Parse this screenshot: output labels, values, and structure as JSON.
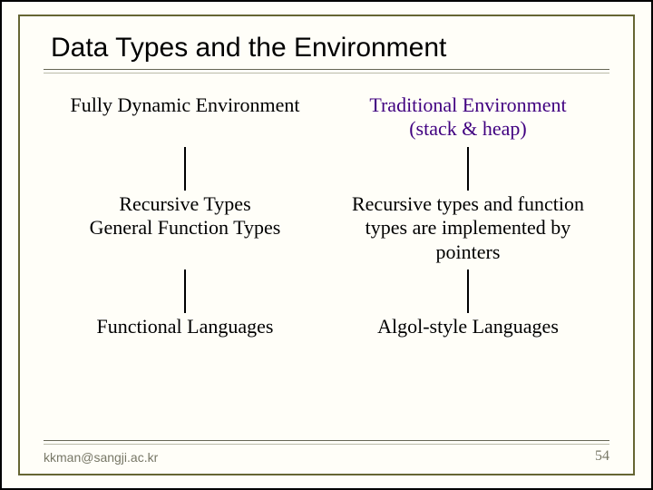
{
  "title": "Data Types and the Environment",
  "left": {
    "top": "Fully Dynamic Environment",
    "mid_line1": "Recursive Types",
    "mid_line2": "General Function Types",
    "bottom": "Functional Languages"
  },
  "right": {
    "top_line1": "Traditional Environment",
    "top_line2": "(stack & heap)",
    "mid": "Recursive types and function types are implemented by pointers",
    "bottom": "Algol-style Languages"
  },
  "footer": {
    "email": "kkman@sangji.ac.kr",
    "page": "54"
  }
}
